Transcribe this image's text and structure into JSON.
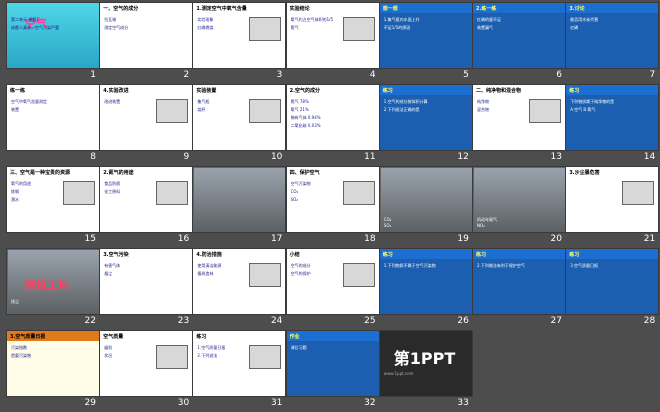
{
  "slides": [
    {
      "n": "1",
      "style": "cyan",
      "title": "空气",
      "texts": [
        "第二单元 课题1",
        "成都人真多，空气污染严重"
      ]
    },
    {
      "n": "2",
      "style": "white",
      "title": "一、空气的成分",
      "texts": [
        "拉瓦锡",
        "测定空气成分"
      ]
    },
    {
      "n": "3",
      "style": "white",
      "title": "1.测定空气中氧气含量",
      "texts": [
        "实验现象",
        "红磷燃烧"
      ]
    },
    {
      "n": "4",
      "style": "white",
      "title": "实验结论",
      "texts": [
        "氧气约占空气体积的1/5",
        "氮气"
      ]
    },
    {
      "n": "5",
      "style": "blue",
      "title": "想一想",
      "texts": [
        "1.集气瓶内水面上升",
        "不足1/5的原因"
      ]
    },
    {
      "n": "6",
      "style": "blue",
      "title": "2.练一练",
      "texts": [
        "红磷的量不足",
        "装置漏气"
      ]
    },
    {
      "n": "7",
      "style": "blue",
      "title": "3.讨论",
      "texts": [
        "能否用木炭代替",
        "红磷"
      ]
    },
    {
      "n": "8",
      "style": "white",
      "title": "练一练",
      "texts": [
        "空气中氧气含量测定",
        "装置"
      ]
    },
    {
      "n": "9",
      "style": "white",
      "title": "4.实验改进",
      "texts": [
        "改进装置"
      ]
    },
    {
      "n": "10",
      "style": "white",
      "title": "实验装置",
      "texts": [
        "集气瓶",
        "烧杯"
      ]
    },
    {
      "n": "11",
      "style": "white",
      "title": "2.空气的成分",
      "texts": [
        "氮气 78%",
        "氧气 21%",
        "稀有气体 0.94%",
        "二氧化碳 0.03%"
      ]
    },
    {
      "n": "12",
      "style": "blue",
      "title": "练习",
      "texts": [
        "1.空气的成分按体积计算",
        "2.下列说法正确的是"
      ]
    },
    {
      "n": "13",
      "style": "white",
      "title": "二、纯净物和混合物",
      "texts": [
        "纯净物",
        "混合物"
      ]
    },
    {
      "n": "14",
      "style": "blue",
      "title": "练习",
      "texts": [
        "下列物质属于纯净物的是",
        "A.空气 B.氧气"
      ]
    },
    {
      "n": "15",
      "style": "white",
      "title": "三、空气是一种宝贵的资源",
      "texts": [
        "氧气的用途",
        "炼钢",
        "潜水"
      ]
    },
    {
      "n": "16",
      "style": "white",
      "title": "2.氮气的用途",
      "texts": [
        "食品防腐",
        "化工原料"
      ]
    },
    {
      "n": "17",
      "style": "photo",
      "title": "",
      "texts": []
    },
    {
      "n": "18",
      "style": "white",
      "title": "四、保护空气",
      "texts": [
        "空气污染物",
        "CO₂",
        "SO₂"
      ]
    },
    {
      "n": "19",
      "style": "photo",
      "title": "",
      "texts": [
        "CO₂",
        "SO₂"
      ]
    },
    {
      "n": "20",
      "style": "photo",
      "title": "",
      "texts": [
        "机动车尾气",
        "NO₂"
      ]
    },
    {
      "n": "21",
      "style": "white",
      "title": "3.沙尘暴危害",
      "texts": []
    },
    {
      "n": "22",
      "style": "photo",
      "title": "建筑工地",
      "texts": [
        "扬尘"
      ]
    },
    {
      "n": "23",
      "style": "white",
      "title": "3.空气污染",
      "texts": [
        "有害气体",
        "烟尘"
      ]
    },
    {
      "n": "24",
      "style": "white",
      "title": "4.防治措施",
      "texts": [
        "使用清洁能源",
        "植树造林"
      ]
    },
    {
      "n": "25",
      "style": "white",
      "title": "小结",
      "texts": [
        "空气的成分",
        "空气的保护"
      ]
    },
    {
      "n": "26",
      "style": "blue",
      "title": "练习",
      "texts": [
        "1.下列物质不属于空气污染物"
      ]
    },
    {
      "n": "27",
      "style": "blue",
      "title": "练习",
      "texts": [
        "2.下列做法有利于保护空气"
      ]
    },
    {
      "n": "28",
      "style": "blue",
      "title": "练习",
      "texts": [
        "3.空气质量日报"
      ]
    },
    {
      "n": "29",
      "style": "cream",
      "title": "3.空气质量日报",
      "texts": [
        "污染指数",
        "首要污染物"
      ]
    },
    {
      "n": "30",
      "style": "white",
      "title": "空气质量",
      "texts": [
        "级别",
        "状况"
      ]
    },
    {
      "n": "31",
      "style": "white",
      "title": "练习",
      "texts": [
        "1.空气质量日报",
        "2.下列说法"
      ]
    },
    {
      "n": "32",
      "style": "blue",
      "title": "作业",
      "texts": [
        "课后习题"
      ]
    },
    {
      "n": "33",
      "style": "dark",
      "title": "第1PPT",
      "texts": [
        "www.1ppt.com"
      ]
    }
  ],
  "colors": {
    "background": "#4d4d4d",
    "cyan": "#4fd6e6",
    "blue": "#1c5fb0",
    "number": "#ffffff"
  }
}
